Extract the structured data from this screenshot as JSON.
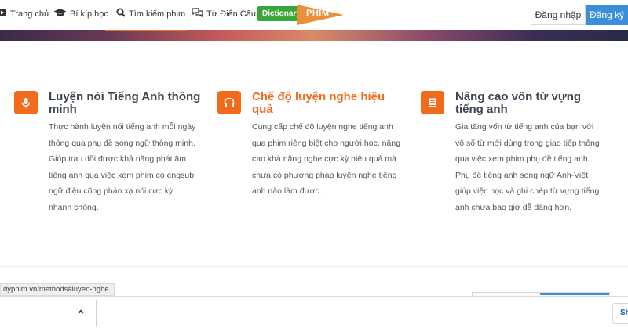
{
  "nav": {
    "home": "Trang chủ",
    "tips": "Bí kíp học",
    "search": "Tìm kiếm phim",
    "dictionary": "Từ Điển Câu",
    "dict_badge": "Dictionary",
    "logo_text": "PHIM",
    "login": "Đăng nhập",
    "register": "Đăng ký"
  },
  "features": [
    {
      "title": "Luyện nói Tiếng Anh thông minh",
      "icon": "microphone-icon",
      "lines": [
        "Thực hành luyện nói tiếng anh mỗi ngày",
        "thông qua phụ đề song ngữ thông minh.",
        "Giúp trau dồi được khả năng phát âm",
        "tiếng anh qua việc xem phim có engsub,",
        "ngữ điệu cũng phản xạ nói cực kỳ",
        "nhanh chóng."
      ]
    },
    {
      "title": "Chế độ luyện nghe hiệu quả",
      "icon": "headphones-icon",
      "lines": [
        "Cung cấp chế độ luyện nghe tiếng anh",
        "qua phim riêng biệt cho người học, nâng",
        "cao khả năng nghe cực kỳ hiệu quả mà",
        "chưa có phương pháp luyện nghe tiếng",
        "anh nào làm được."
      ]
    },
    {
      "title": "Nâng cao vốn từ vựng tiếng anh",
      "icon": "book-icon",
      "lines": [
        "Gia tăng vốn từ tiếng anh của bạn với",
        "vô số từ mới dùng trong giao tiếp thông",
        "qua việc xem phim phụ đề tiếng anh.",
        "Phụ đề tiếng anh song ngữ Anh-Việt",
        "giúp việc học và ghi chép từ vựng tiếng",
        "anh chưa bao giờ dễ dàng hơn."
      ]
    }
  ],
  "status_url": "dyphim.vn/methods#luyen-nghe",
  "download_bar": {
    "show_all": "Sh"
  },
  "colors": {
    "accent_orange": "#f26b1d",
    "register_blue": "#3b8fd8",
    "dictionary_green": "#3aa53a",
    "title_dark": "#3d4350"
  }
}
